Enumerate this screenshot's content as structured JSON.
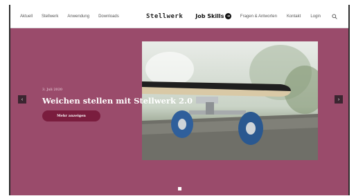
{
  "nav": {
    "left_links": [
      "Aktuell",
      "Stellwerk",
      "Anwendung",
      "Downloads"
    ],
    "brand_stellwerk": "Stellwerk",
    "brand_jobskills": "Job Skills",
    "right_links": [
      "Fragen & Antworten",
      "Kontakt",
      "Login"
    ],
    "search_icon": "search-icon"
  },
  "hero": {
    "date": "3. Juli 2020",
    "title": "Weichen stellen mit Stellwerk 2.0",
    "button_label": "Mehr anzeigen",
    "image_subject": "skateboard"
  },
  "carousel": {
    "prev_icon": "chevron-left-icon",
    "next_icon": "chevron-right-icon",
    "prev_glyph": "‹",
    "next_glyph": "›",
    "active_slide": 1
  },
  "colors": {
    "hero_background": "#9a4b6b",
    "button": "#7a1d3e"
  }
}
